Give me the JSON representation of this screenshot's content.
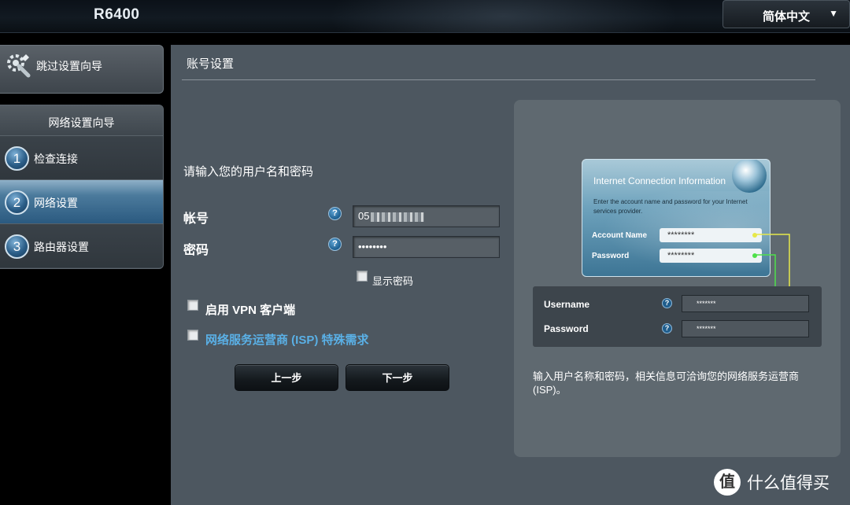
{
  "header": {
    "model": "R6400",
    "language": "简体中文"
  },
  "nav": {
    "skip_label": "跳过设置向导",
    "wizard_title": "网络设置向导",
    "steps": [
      {
        "num": "1",
        "label": "检查连接"
      },
      {
        "num": "2",
        "label": "网络设置",
        "active": true
      },
      {
        "num": "3",
        "label": "路由器设置"
      }
    ]
  },
  "main": {
    "title": "账号设置",
    "prompt": "请输入您的用户名和密码",
    "account_label": "帐号",
    "account_value_visible": "05",
    "password_label": "密码",
    "password_value": "••••••••",
    "help_glyph": "?",
    "show_password_label": "显示密码",
    "vpn_label": "启用 VPN 客户端",
    "isp_label": "网络服务运营商 (ISP) 特殊需求",
    "prev_label": "上一步",
    "next_label": "下一步"
  },
  "info": {
    "card_title": "Internet Connection Information",
    "card_desc": "Enter the account name and password for your Internet services provider.",
    "card_account_label": "Account Name",
    "card_password_label": "Password",
    "card_mask": "********",
    "form_username_label": "Username",
    "form_password_label": "Password",
    "form_mask": "*******",
    "description": "输入用户名称和密码，相关信息可洽询您的网络服务运营商 (ISP)。"
  },
  "watermark": {
    "logo_glyph": "值",
    "text": "什么值得买"
  },
  "colors": {
    "accent_link": "#5ab0e6",
    "active_step": "#2b5a80",
    "panel_bg": "#4d5760",
    "yellow_line": "#e6e84a",
    "green_line": "#4ee04a"
  }
}
